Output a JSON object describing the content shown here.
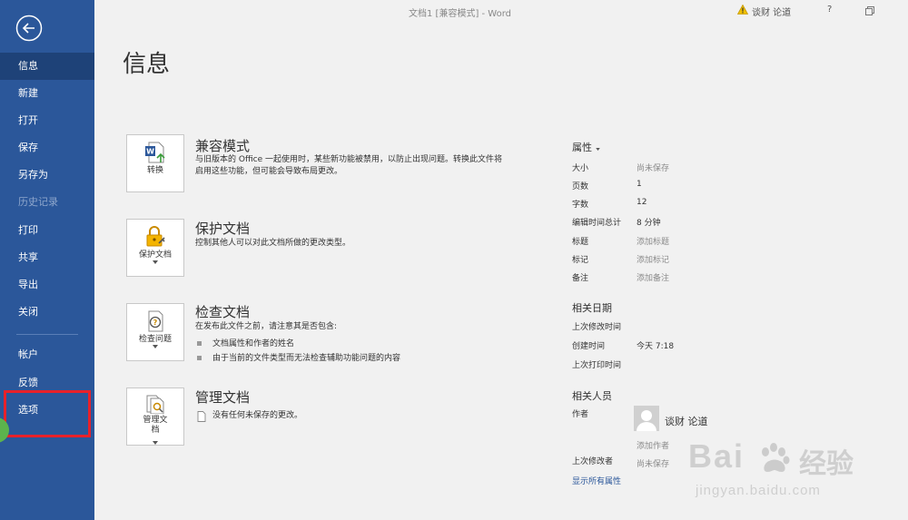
{
  "window": {
    "title": "文档1 [兼容模式] - Word",
    "warning_icon": "warning-icon",
    "user": "谈财 论道",
    "help": "?",
    "restore_icon": "restore-icon"
  },
  "sidebar": {
    "items": [
      {
        "label": "信息",
        "state": "active"
      },
      {
        "label": "新建",
        "state": "normal"
      },
      {
        "label": "打开",
        "state": "normal"
      },
      {
        "label": "保存",
        "state": "normal"
      },
      {
        "label": "另存为",
        "state": "normal"
      },
      {
        "label": "历史记录",
        "state": "disabled"
      },
      {
        "label": "打印",
        "state": "normal"
      },
      {
        "label": "共享",
        "state": "normal"
      },
      {
        "label": "导出",
        "state": "normal"
      },
      {
        "label": "关闭",
        "state": "normal"
      },
      {
        "label": "帐户",
        "state": "normal"
      },
      {
        "label": "反馈",
        "state": "normal"
      },
      {
        "label": "选项",
        "state": "highlighted"
      }
    ],
    "accent_color": "#2b579a",
    "active_color": "#1e4278",
    "highlight_color": "#e8212a"
  },
  "main": {
    "title": "信息",
    "sections": {
      "convert": {
        "button_label": "转换",
        "title": "兼容模式",
        "desc_line1": "与旧版本的 Office 一起使用时，某些新功能被禁用，以防止出现问题。转换此文件将",
        "desc_line2": "启用这些功能，但可能会导致布局更改。"
      },
      "protect": {
        "button_label": "保护文档",
        "title": "保护文档",
        "desc": "控制其他人可以对此文档所做的更改类型。"
      },
      "inspect": {
        "button_label": "检查问题",
        "title": "检查文档",
        "desc": "在发布此文件之前，请注意其是否包含:",
        "bullets": [
          "文档属性和作者的姓名",
          "由于当前的文件类型而无法检查辅助功能问题的内容"
        ]
      },
      "manage": {
        "button_label_1": "管理文",
        "button_label_2": "档",
        "title": "管理文档",
        "desc": "没有任何未保存的更改。"
      }
    }
  },
  "properties": {
    "heading": "属性",
    "rows": [
      {
        "label": "大小",
        "value": "尚未保存"
      },
      {
        "label": "页数",
        "value": "1"
      },
      {
        "label": "字数",
        "value": "12"
      },
      {
        "label": "编辑时间总计",
        "value": "8 分钟"
      },
      {
        "label": "标题",
        "value": "添加标题"
      },
      {
        "label": "标记",
        "value": "添加标记"
      },
      {
        "label": "备注",
        "value": "添加备注"
      }
    ],
    "dates_heading": "相关日期",
    "dates": [
      {
        "label": "上次修改时间",
        "value": ""
      },
      {
        "label": "创建时间",
        "value": "今天 7:18"
      },
      {
        "label": "上次打印时间",
        "value": ""
      }
    ],
    "people_heading": "相关人员",
    "author_label": "作者",
    "author_name": "谈财 论道",
    "add_author": "添加作者",
    "last_modified_by_label": "上次修改者",
    "last_modified_by_value": "尚未保存",
    "show_all": "显示所有属性"
  },
  "watermark": {
    "brand": "Bai",
    "brand_cn": "经验",
    "url": "jingyan.baidu.com"
  }
}
